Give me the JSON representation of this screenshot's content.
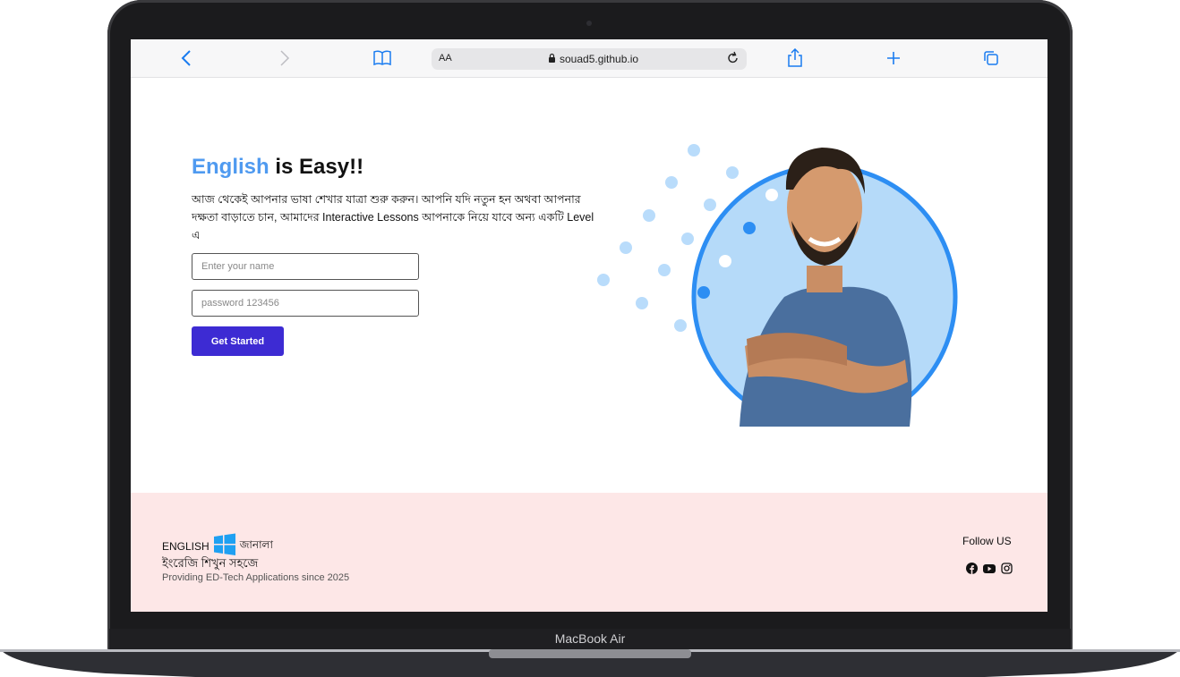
{
  "device": {
    "label": "MacBook Air"
  },
  "browser": {
    "text_size_label": "AA",
    "url": "souad5.github.io",
    "icons": [
      "back-icon",
      "forward-icon",
      "bookmarks-icon",
      "lock-icon",
      "reload-icon",
      "share-icon",
      "new-tab-icon",
      "tabs-icon"
    ]
  },
  "hero": {
    "title_accent": "English",
    "title_rest": " is Easy!!",
    "description": "আজ থেকেই আপনার ভাষা শেখার যাত্রা শুরু করুন। আপনি যদি নতুন হন অথবা আপনার দক্ষতা বাড়াতে চান, আমাদের Interactive Lessons আপনাকে নিয়ে যাবে অন্য একটি Level এ",
    "name_placeholder": "Enter your name",
    "password_placeholder": "password 123456",
    "cta_label": "Get Started"
  },
  "footer": {
    "brand_left": "ENGLISH",
    "brand_right": "জানালা",
    "tagline_bn": "ইংরেজি শিখুন সহজে",
    "since": "Providing ED-Tech Applications since 2025",
    "follow_label": "Follow US",
    "social_icons": [
      "facebook-icon",
      "youtube-icon",
      "instagram-icon"
    ]
  },
  "colors": {
    "accent": "#4f9af0",
    "cta": "#3d2bd3",
    "footer_bg": "#fde7e7",
    "circle_ring": "#2d8ef3",
    "circle_fill": "#b5daf9"
  }
}
